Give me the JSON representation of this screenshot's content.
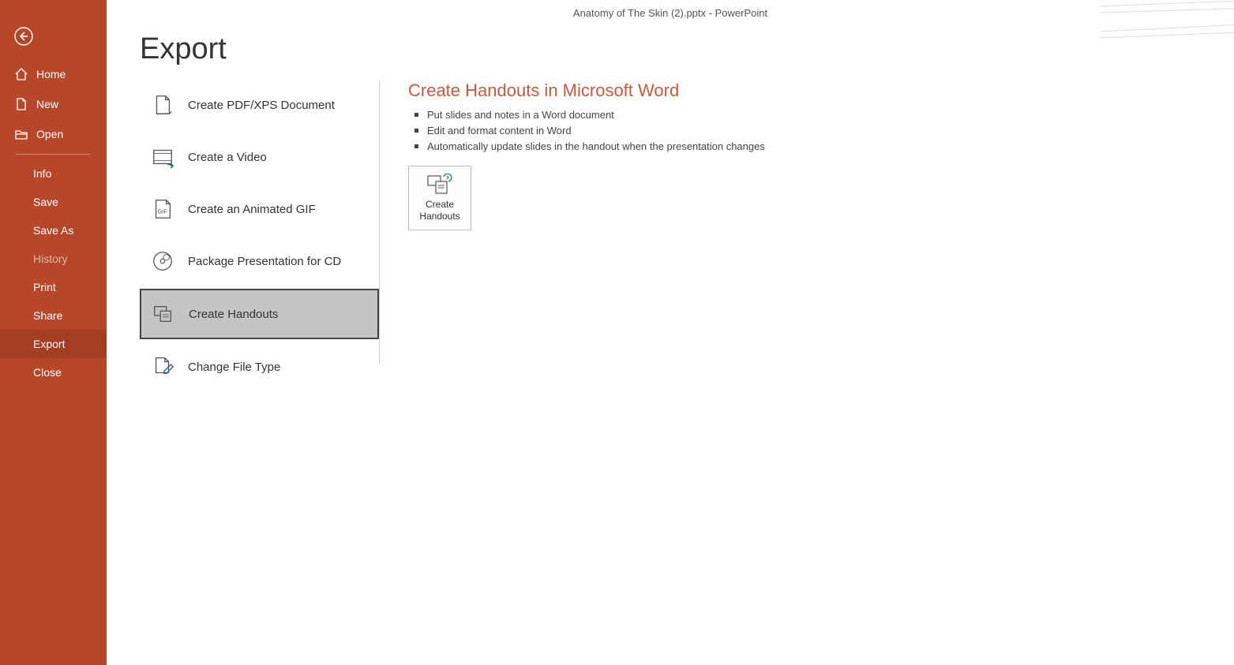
{
  "colors": {
    "accent": "#B7472A",
    "heading": "#C35A3E"
  },
  "titlebar": {
    "filename": "Anatomy of The Skin (2).pptx",
    "separator": "  -  ",
    "app": "PowerPoint"
  },
  "sidebar": {
    "home": "Home",
    "new": "New",
    "open": "Open",
    "info": "Info",
    "save": "Save",
    "save_as": "Save As",
    "history": "History",
    "print": "Print",
    "share": "Share",
    "export": "Export",
    "close": "Close"
  },
  "page": {
    "title": "Export"
  },
  "export_options": [
    {
      "id": "pdf-xps",
      "label": "Create PDF/XPS Document"
    },
    {
      "id": "video",
      "label": "Create a Video"
    },
    {
      "id": "gif",
      "label": "Create an Animated GIF"
    },
    {
      "id": "package-cd",
      "label": "Package Presentation for CD"
    },
    {
      "id": "handouts",
      "label": "Create Handouts"
    },
    {
      "id": "change-type",
      "label": "Change File Type"
    }
  ],
  "detail": {
    "heading": "Create Handouts in Microsoft Word",
    "bullets": [
      "Put slides and notes in a Word document",
      "Edit and format content in Word",
      "Automatically update slides in the handout when the presentation changes"
    ],
    "button_line1": "Create",
    "button_line2": "Handouts"
  }
}
